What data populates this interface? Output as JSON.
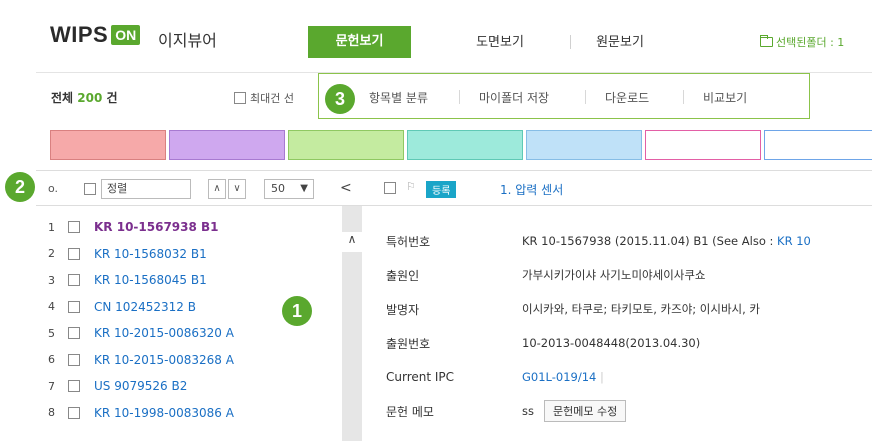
{
  "header": {
    "logo_text": "WIPS",
    "logo_badge": "ON",
    "app_name": "이지뷰어",
    "tabs": [
      {
        "label": "문헌보기",
        "active": true
      },
      {
        "label": "도면보기",
        "active": false
      },
      {
        "label": "원문보기",
        "active": false
      }
    ],
    "selected_folder": "선택된폴더 : 1"
  },
  "toolbar": {
    "total_prefix": "전체",
    "total_count": "200",
    "total_suffix": "건",
    "max_checkbox_label": "최대건 선",
    "actions": [
      "항목별 분류",
      "마이폴더 저장",
      "다운로드",
      "비교보기"
    ]
  },
  "swatches": [
    {
      "fill": "#f6a9a9",
      "border": "#d98080"
    },
    {
      "fill": "#cfa8ef",
      "border": "#a87ad1"
    },
    {
      "fill": "#c4eba0",
      "border": "#8fc862"
    },
    {
      "fill": "#9deadb",
      "border": "#5fc9b5"
    },
    {
      "fill": "#bfe1f8",
      "border": "#86bde6"
    },
    {
      "fill": "#ffffff",
      "border": "#e35fa6"
    },
    {
      "fill": "#ffffff",
      "border": "#6ea5e8"
    }
  ],
  "badges": [
    "1",
    "2",
    "3"
  ],
  "list_header": {
    "no_label": "o.",
    "sort_value": "정렬",
    "up_arrow": "∧",
    "down_arrow": "∨",
    "page_size": "50",
    "collapse": "<"
  },
  "list": [
    {
      "idx": "1",
      "number": "KR 10-1567938 B1",
      "selected": true
    },
    {
      "idx": "2",
      "number": "KR 10-1568032 B1",
      "selected": false
    },
    {
      "idx": "3",
      "number": "KR 10-1568045 B1",
      "selected": false
    },
    {
      "idx": "4",
      "number": "CN 102452312 B",
      "selected": false
    },
    {
      "idx": "5",
      "number": "KR 10-2015-0086320 A",
      "selected": false
    },
    {
      "idx": "6",
      "number": "KR 10-2015-0083268 A",
      "selected": false
    },
    {
      "idx": "7",
      "number": "US 9079526 B2",
      "selected": false
    },
    {
      "idx": "8",
      "number": "KR 10-1998-0083086 A",
      "selected": false
    }
  ],
  "detail_header": {
    "status_badge": "등록",
    "title": "1. 압력 센서"
  },
  "detail": {
    "patent_no": {
      "label": "특허번호",
      "value": "KR 10-1567938 (2015.11.04) B1 (See Also : ",
      "link": "KR 10"
    },
    "applicant": {
      "label": "출원인",
      "value": "가부시키가이샤 사기노미야세이사쿠쇼"
    },
    "inventor": {
      "label": "발명자",
      "value": "이시카와, 타쿠로; 타키모토, 카즈야; 이시바시, 카"
    },
    "app_no": {
      "label": "출원번호",
      "value": "10-2013-0048448(2013.04.30)"
    },
    "ipc": {
      "label": "Current IPC",
      "value": "G01L-019/14",
      "sep": "|"
    },
    "memo": {
      "label": "문헌 메모",
      "value": "ss",
      "button": "문헌메모 수정"
    }
  },
  "colors": {
    "accent": "#5aa82e",
    "link": "#1a6fc4",
    "selected_link": "#7b2f8e",
    "status_badge": "#1aa5c8"
  }
}
